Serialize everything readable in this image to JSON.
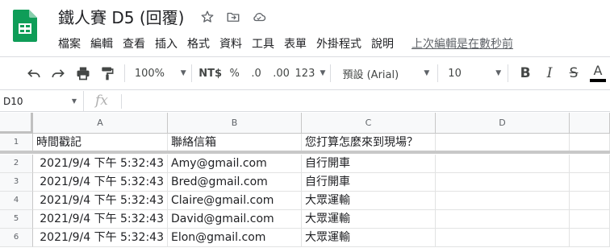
{
  "document": {
    "title": "鐵人賽 D5 (回覆)"
  },
  "menu": {
    "items": [
      "檔案",
      "編輯",
      "查看",
      "插入",
      "格式",
      "資料",
      "工具",
      "表單",
      "外掛程式",
      "說明"
    ],
    "last_edit": "上次編輯是在數秒前"
  },
  "toolbar": {
    "zoom": "100%",
    "currency": "NT$",
    "percent": "%",
    "decrease_decimal": ".0",
    "increase_decimal": ".00",
    "more_formats": "123",
    "font_family": "預設 (Arial)",
    "font_size": "10",
    "bold": "B",
    "italic": "I",
    "strikethrough": "S",
    "text_color": "A",
    "text_color_value": "#000000"
  },
  "formula_bar": {
    "name_box": "D10",
    "fx_label": "fx",
    "formula": ""
  },
  "sheet": {
    "columns": [
      "A",
      "B",
      "C",
      "D"
    ],
    "row_numbers": [
      "1",
      "2",
      "3",
      "4",
      "5",
      "6"
    ],
    "rows": [
      [
        "時間戳記",
        "聯絡信箱",
        "您打算怎麼來到現場？",
        ""
      ],
      [
        "2021/9/4 下午 5:32:43",
        "Amy@gmail.com",
        "自行開車",
        ""
      ],
      [
        "2021/9/4 下午 5:32:43",
        "Bred@gmail.com",
        "自行開車",
        ""
      ],
      [
        "2021/9/4 下午 5:32:43",
        "Claire@gmail.com",
        "大眾運輸",
        ""
      ],
      [
        "2021/9/4 下午 5:32:43",
        "David@gmail.com",
        "大眾運輸",
        ""
      ],
      [
        "2021/9/4 下午 5:32:43",
        "Elon@gmail.com",
        "大眾運輸",
        ""
      ]
    ]
  },
  "colors": {
    "sheets_green": "#0f9d58",
    "header_bg": "#f8f9fa",
    "grid_line": "#e2e3e3"
  }
}
